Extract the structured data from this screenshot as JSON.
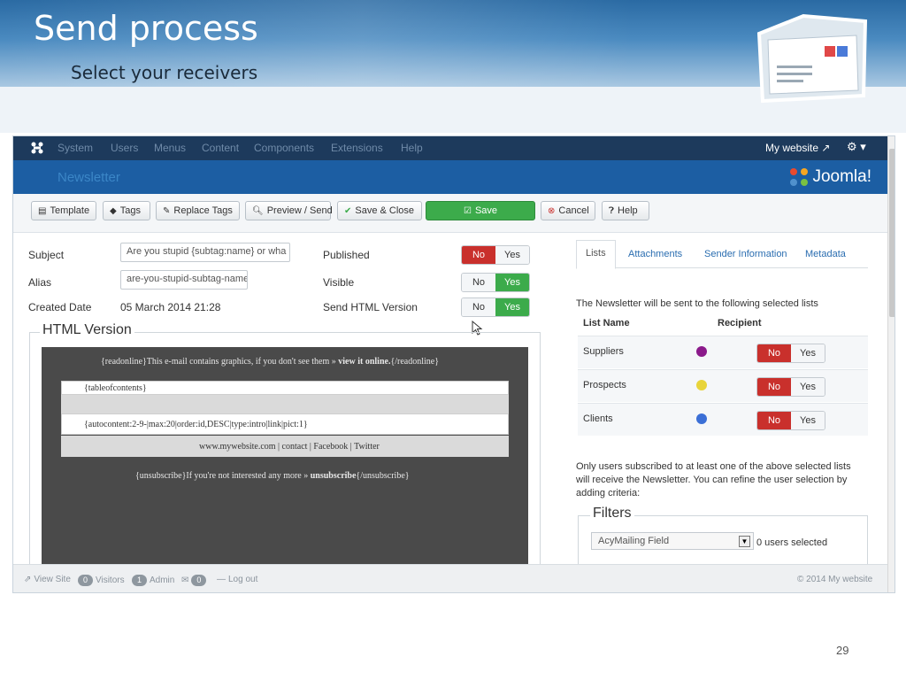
{
  "slide": {
    "title": "Send process",
    "subtitle": "Select your receivers",
    "page_number": "29"
  },
  "admin": {
    "menu": [
      "System",
      "Users",
      "Menus",
      "Content",
      "Components",
      "Extensions",
      "Help"
    ],
    "site_link": "My website",
    "page_heading": "Newsletter",
    "brand": "Joomla!"
  },
  "toolbar": {
    "template": "Template",
    "tags": "Tags",
    "replace_tags": "Replace Tags",
    "preview_send": "Preview / Send",
    "save_close": "Save & Close",
    "save": "Save",
    "cancel": "Cancel",
    "help": "Help"
  },
  "form": {
    "subject_label": "Subject",
    "subject_value": "Are you stupid {subtag:name} or wha",
    "alias_label": "Alias",
    "alias_value": "are-you-stupid-subtag-name",
    "created_label": "Created Date",
    "created_value": "05 March 2014 21:28",
    "published_label": "Published",
    "visible_label": "Visible",
    "send_html_label": "Send HTML Version",
    "no": "No",
    "yes": "Yes",
    "published_value": "No",
    "visible_value": "Yes",
    "send_html_value": "Yes"
  },
  "editor": {
    "legend": "HTML Version",
    "readonline_pre": "{readonline}This e-mail contains graphics, if you don't see them » ",
    "readonline_bold": "view it online.",
    "readonline_post": "{/readonline}",
    "toc": "{tableofcontents}",
    "autocontent": "{autocontent:2-9-|max:20|order:id,DESC|type:intro|link|pict:1}",
    "footer_links": "www.mywebsite.com | contact | Facebook | Twitter",
    "unsub_pre": "{unsubscribe}If you're not interested any more » ",
    "unsub_bold": "unsubscribe",
    "unsub_post": "{/unsubscribe}"
  },
  "tabs": [
    "Lists",
    "Attachments",
    "Sender Information",
    "Metadata"
  ],
  "lists": {
    "intro": "The Newsletter will be sent to the following selected lists",
    "col_name": "List Name",
    "col_recipient": "Recipient",
    "rows": [
      {
        "name": "Suppliers",
        "color": "#8b1a8b",
        "value": "No"
      },
      {
        "name": "Prospects",
        "color": "#e8d43a",
        "value": "No"
      },
      {
        "name": "Clients",
        "color": "#3b6fd6",
        "value": "No"
      }
    ]
  },
  "filters": {
    "note": "Only users subscribed to at least one of the above selected lists will receive the Newsletter. You can refine the user selection by adding criteria:",
    "legend": "Filters",
    "select_value": "AcyMailing Field",
    "count": "0 users selected"
  },
  "status": {
    "view_site": "View Site",
    "visitors_count": "0",
    "visitors": "Visitors",
    "admin_count": "1",
    "admin": "Admin",
    "messages_count": "0",
    "logout": "Log out",
    "copyright": "© 2014 My website"
  },
  "colors": {
    "topbar": "#1d3a5c",
    "subbar": "#1c5ea3",
    "no_red": "#c9302c",
    "yes_green": "#3cab4b"
  }
}
